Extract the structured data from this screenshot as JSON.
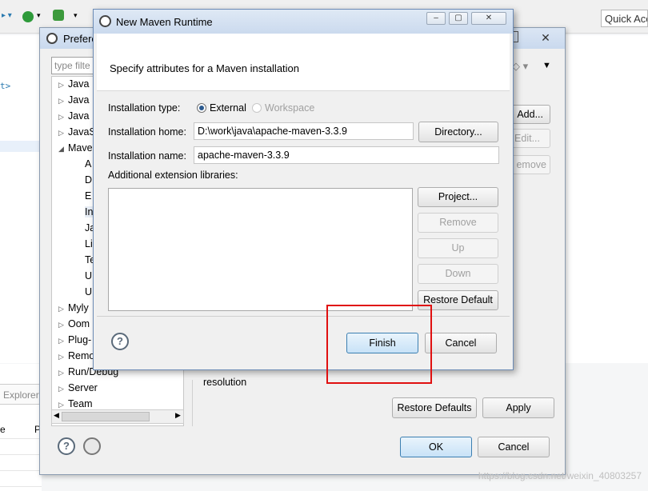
{
  "background": {
    "quick_access": "Quick Acc",
    "explorer_tab": "Explorer",
    "left_letters": [
      "e",
      "P"
    ],
    "code_fragment": "t>",
    "watermark": "https://blog.csdn.net/weixin_40803257"
  },
  "preferences": {
    "title": "Prefere",
    "filter_placeholder": "type filte",
    "tree": [
      {
        "label": "Java",
        "arrow": "right"
      },
      {
        "label": "Java",
        "arrow": "right"
      },
      {
        "label": "Java",
        "arrow": "right"
      },
      {
        "label": "JavaS",
        "arrow": "right"
      },
      {
        "label": "Mave",
        "arrow": "down"
      },
      {
        "label": "A",
        "arrow": ""
      },
      {
        "label": "D",
        "arrow": ""
      },
      {
        "label": "E",
        "arrow": ""
      },
      {
        "label": "In",
        "arrow": ""
      },
      {
        "label": "Ja",
        "arrow": ""
      },
      {
        "label": "Li",
        "arrow": ""
      },
      {
        "label": "Te",
        "arrow": ""
      },
      {
        "label": "U",
        "arrow": ""
      },
      {
        "label": "U",
        "arrow": ""
      },
      {
        "label": "Myly",
        "arrow": "right"
      },
      {
        "label": "Oom",
        "arrow": "right"
      },
      {
        "label": "Plug-",
        "arrow": "right"
      },
      {
        "label": "Remo",
        "arrow": "right"
      },
      {
        "label": "Run/Debug",
        "arrow": "right"
      },
      {
        "label": "Server",
        "arrow": "right"
      },
      {
        "label": "Team",
        "arrow": "right"
      }
    ],
    "side_buttons": {
      "add": "Add...",
      "edit": "Edit...",
      "remove": "emove"
    },
    "resolution_text": "resolution",
    "restore_defaults": "Restore Defaults",
    "apply": "Apply",
    "ok": "OK",
    "cancel": "Cancel"
  },
  "maven_dialog": {
    "title": "New Maven Runtime",
    "header": "Specify attributes for a Maven installation",
    "installation_type_label": "Installation type:",
    "type_external": "External",
    "type_workspace": "Workspace",
    "home_label": "Installation home:",
    "home_value": "D:\\work\\java\\apache-maven-3.3.9",
    "directory_button": "Directory...",
    "name_label": "Installation name:",
    "name_value": "apache-maven-3.3.9",
    "ext_label": "Additional extension libraries:",
    "project_button": "Project...",
    "remove_button": "Remove",
    "up_button": "Up",
    "down_button": "Down",
    "restore_default_button": "Restore Default",
    "finish_button": "Finish",
    "cancel_button": "Cancel"
  }
}
